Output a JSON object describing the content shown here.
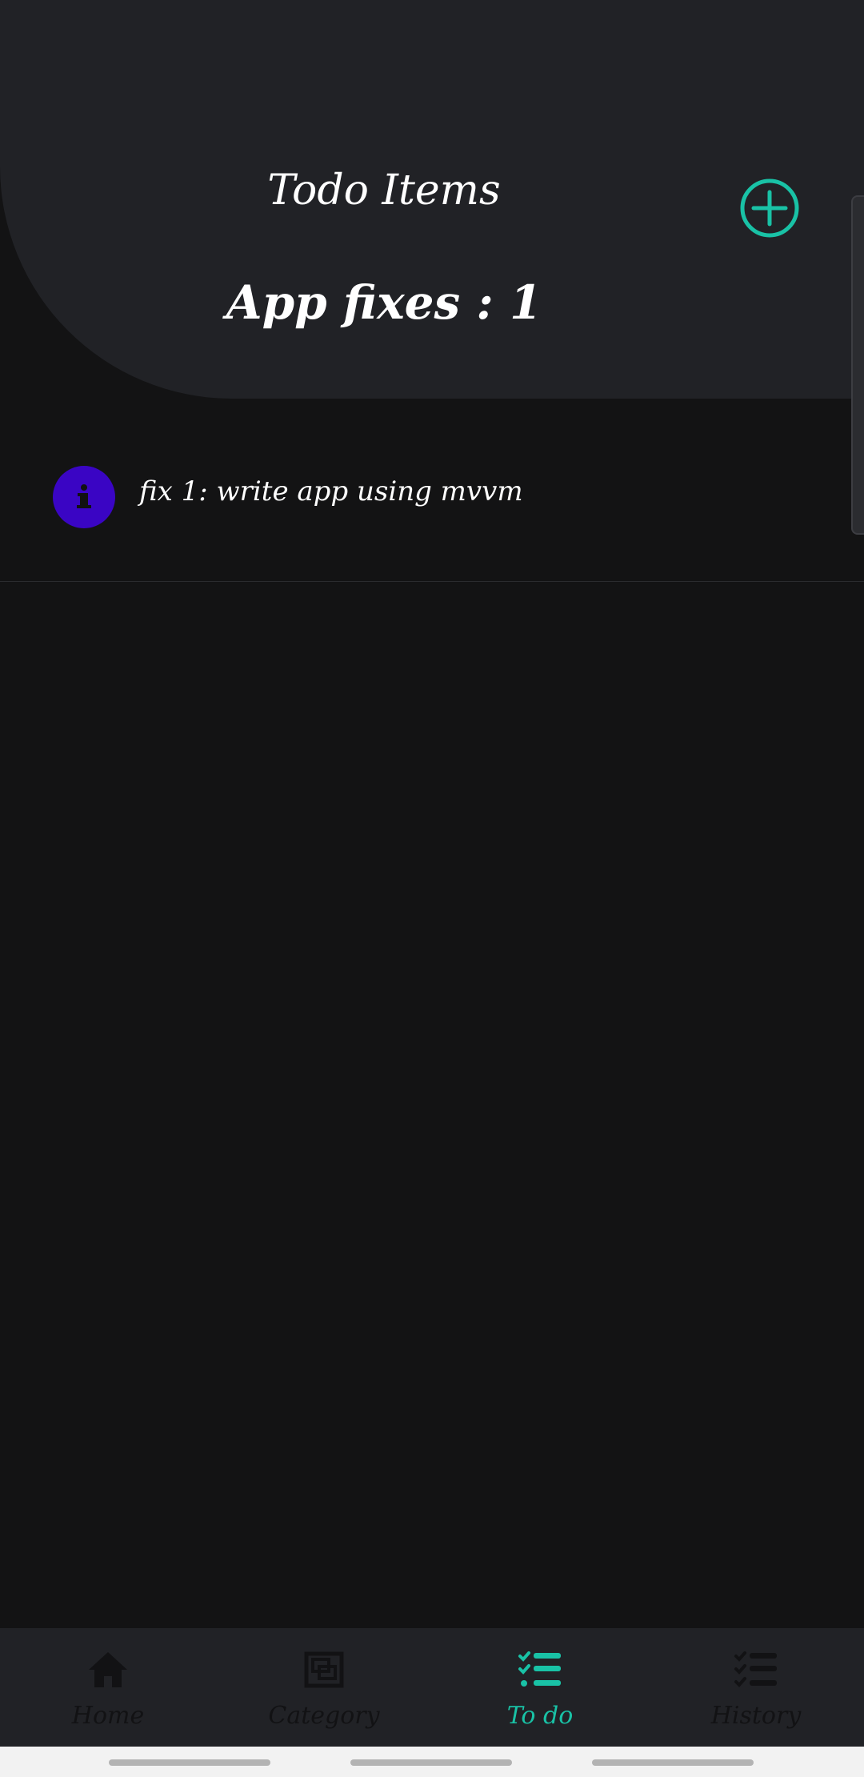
{
  "header": {
    "title": "Todo Items",
    "subtitle": "App fixes : 1",
    "add_icon": "plus-circle-icon"
  },
  "todos": [
    {
      "text": "fix 1: write app using mvvm",
      "icon": "info-icon"
    }
  ],
  "bottom_nav": {
    "items": [
      {
        "label": "Home",
        "icon": "home-icon",
        "active": false
      },
      {
        "label": "Category",
        "icon": "category-icon",
        "active": false
      },
      {
        "label": "To do",
        "icon": "checklist-icon",
        "active": true
      },
      {
        "label": "History",
        "icon": "history-checklist-icon",
        "active": false
      }
    ]
  },
  "colors": {
    "accent": "#19c2a6",
    "header_bg": "#212226",
    "page_bg": "#131314",
    "info_icon_bg": "#3a05c4",
    "inactive_nav": "#121214"
  }
}
